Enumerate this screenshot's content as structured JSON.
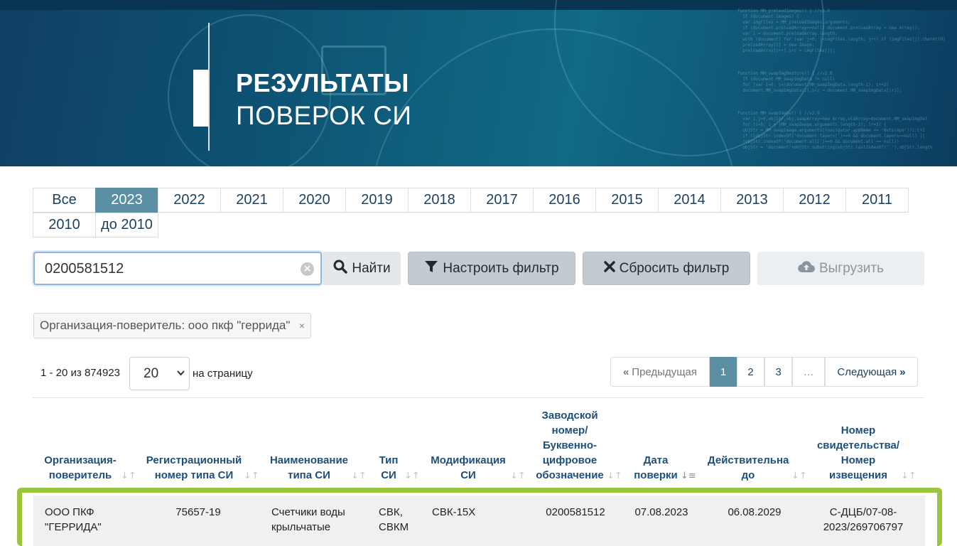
{
  "banner": {
    "title_line1": "РЕЗУЛЬТАТЫ",
    "title_line2": "ПОВЕРОК СИ"
  },
  "years": {
    "tabs": [
      "Все",
      "2023",
      "2022",
      "2021",
      "2020",
      "2019",
      "2018",
      "2017",
      "2016",
      "2015",
      "2014",
      "2013",
      "2012",
      "2011",
      "2010",
      "до 2010"
    ],
    "active": "2023"
  },
  "search": {
    "value": "0200581512",
    "find_label": "Найти",
    "filter_label": "Настроить фильтр",
    "reset_label": "Сбросить фильтр",
    "export_label": "Выгрузить"
  },
  "active_filter": {
    "label": "Организация-поверитель: ооо пкф \"геррида\"",
    "close": "×"
  },
  "paging": {
    "count_text": "1 - 20 из 874923",
    "per_page_value": "20",
    "per_page_label": "на страницу",
    "prev_label": "Предыдущая",
    "pages": [
      "1",
      "2",
      "3",
      "…"
    ],
    "current_page": "1",
    "next_label": "Следующая"
  },
  "table": {
    "headers": {
      "org": [
        "Организация-",
        "поверитель"
      ],
      "reg": [
        "Регистрационный",
        "номер типа СИ"
      ],
      "name": [
        "Наименование",
        "типа СИ"
      ],
      "type": [
        "Тип",
        "СИ"
      ],
      "mod": [
        "Модификация",
        "СИ"
      ],
      "serial": [
        "Заводской",
        "номер/",
        "Буквенно-",
        "цифровое",
        "обозначение"
      ],
      "date": [
        "Дата",
        "поверки"
      ],
      "valid": [
        "Действительна",
        "до"
      ],
      "cert": [
        "Номер",
        "свидетельства/",
        "Номер",
        "извещения"
      ]
    },
    "rows": [
      {
        "org": [
          "ООО ПКФ",
          "\"ГЕРРИДА\""
        ],
        "reg": "75657-19",
        "name": [
          "Счетчики воды",
          "крыльчатые"
        ],
        "type": [
          "СВК,",
          "СВКМ"
        ],
        "mod": "СВК-15Х",
        "serial": "0200581512",
        "date": "07.08.2023",
        "valid": "06.08.2029",
        "cert": [
          "С-ДЦБ/07-08-",
          "2023/269706797"
        ]
      }
    ]
  },
  "colors": {
    "accent": "#5b8fa3",
    "header_text": "#1d4f7a",
    "row_highlight": "#9bc53d"
  }
}
